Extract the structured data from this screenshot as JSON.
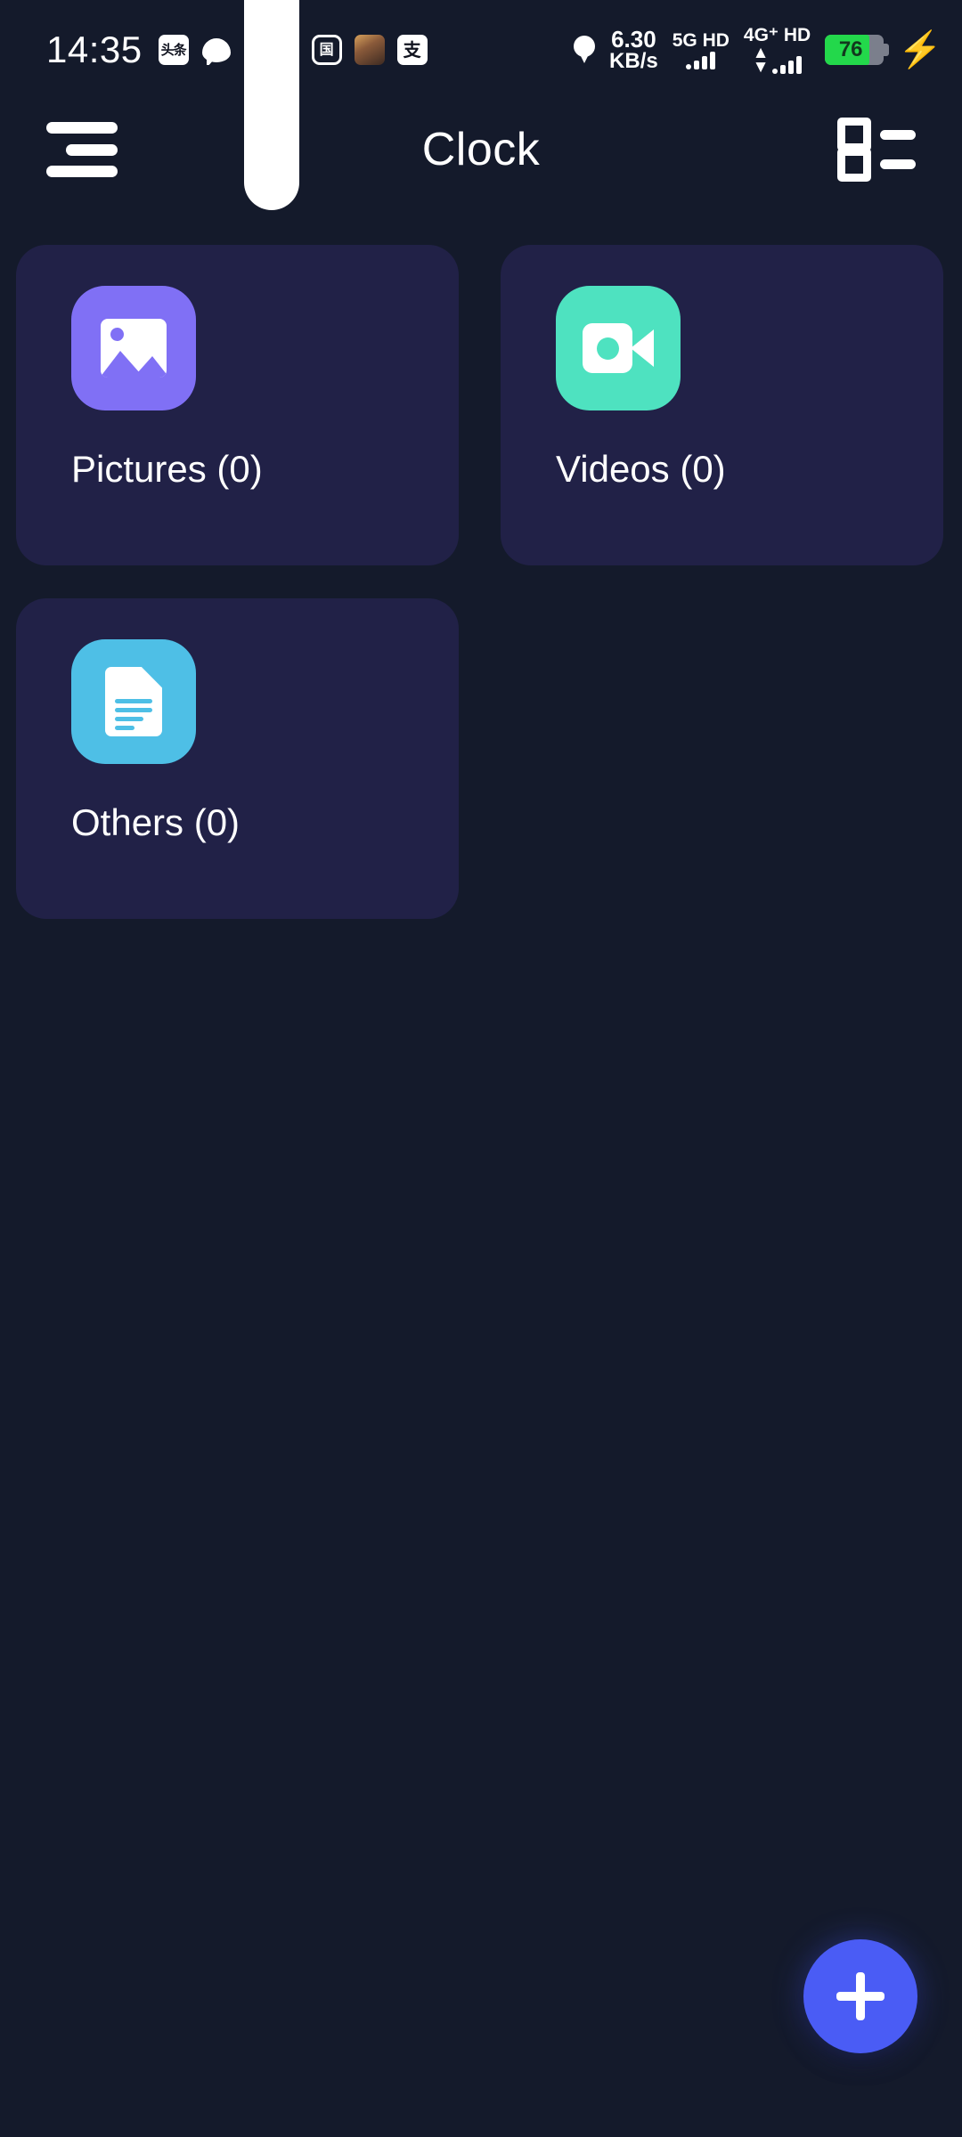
{
  "status_bar": {
    "time": "14:35",
    "notification_icons": [
      {
        "name": "toutiao-icon",
        "glyph": "头条"
      },
      {
        "name": "chat-bubble-icon",
        "glyph": ""
      },
      {
        "name": "wallet-card-icon",
        "glyph": ""
      },
      {
        "name": "guo-circle-icon",
        "glyph": "国"
      },
      {
        "name": "pubg-game-icon",
        "glyph": "PUBG"
      },
      {
        "name": "alipay-icon",
        "glyph": "支"
      }
    ],
    "location_icon": "location-pin-icon",
    "network_speed": "6.30",
    "network_speed_unit": "KB/s",
    "sim1_label": "5G HD",
    "sim2_label": "4G⁺ HD",
    "battery_percent": "76",
    "battery_level": 76,
    "charging_icon": "lightning-bolt-icon",
    "battery_color": "#23d84b",
    "bolt_color": "#ffd21e"
  },
  "app_bar": {
    "menu_icon": "hamburger-menu-icon",
    "title": "Clock",
    "view_toggle_icon": "list-view-icon"
  },
  "grid": {
    "cards": [
      {
        "id": "pictures",
        "label": "Pictures (0)",
        "count": 0,
        "icon_name": "image-icon",
        "icon_color": "#8070f5"
      },
      {
        "id": "videos",
        "label": "Videos (0)",
        "count": 0,
        "icon_name": "video-camera-icon",
        "icon_color": "#4ee2c0"
      },
      {
        "id": "others",
        "label": "Others (0)",
        "count": 0,
        "icon_name": "document-icon",
        "icon_color": "#4ebfe6"
      }
    ]
  },
  "fab": {
    "icon_name": "plus-icon",
    "label": "+",
    "color": "#4a5cf5"
  },
  "theme": {
    "background": "#141a2b",
    "card_background": "#212147",
    "text_primary": "#ffffff"
  }
}
